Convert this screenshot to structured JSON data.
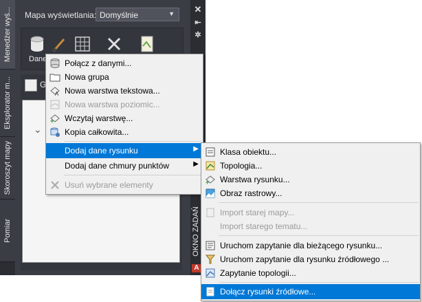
{
  "vertical_tabs": [
    "Menedżer wyś...",
    "Eksplorator m...",
    "Skoroszyt mapy",
    "Pomiar"
  ],
  "map_label": "Mapa wyświetlania:",
  "map_select": "Domyślnie",
  "dane_label": "Dane",
  "g_text": "G",
  "okno_label": "OKNO ZADAŃ",
  "close_icon": "✕",
  "pin_icon": "⇤",
  "settings_icon": "✲",
  "menu1": {
    "items": [
      {
        "label": "Połącz z danymi...",
        "icon": "database-icon",
        "disabled": false
      },
      {
        "label": "Nowa grupa",
        "icon": "folder-icon",
        "disabled": false
      },
      {
        "label": "Nowa warstwa tekstowa...",
        "icon": "text-layer-icon",
        "disabled": false
      },
      {
        "label": "Nowa warstwa poziomic...",
        "icon": "contour-layer-icon",
        "disabled": true
      },
      {
        "label": "Wczytaj warstwę...",
        "icon": "load-layer-icon",
        "disabled": false
      },
      {
        "label": "Kopia całkowita...",
        "icon": "full-copy-icon",
        "disabled": false
      },
      {
        "label": "Dodaj dane rysunku",
        "icon": "",
        "disabled": false,
        "highlighted": true,
        "submenu": true
      },
      {
        "label": "Dodaj dane chmury punktów",
        "icon": "",
        "disabled": false,
        "submenu": true
      },
      {
        "label": "Usuń wybrane elementy",
        "icon": "remove-icon",
        "disabled": true
      }
    ]
  },
  "menu2": {
    "items": [
      {
        "label": "Klasa obiektu...",
        "icon": "feature-class-icon",
        "disabled": false
      },
      {
        "label": "Topologia...",
        "icon": "topology-icon",
        "disabled": false
      },
      {
        "label": "Warstwa rysunku...",
        "icon": "drawing-layer-icon",
        "disabled": false
      },
      {
        "label": "Obraz rastrowy...",
        "icon": "raster-image-icon",
        "disabled": false
      },
      {
        "label": "Import starej mapy...",
        "icon": "import-map-icon",
        "disabled": true
      },
      {
        "label": "Import starego tematu...",
        "icon": "",
        "disabled": true
      },
      {
        "label": "Uruchom zapytanie dla bieżącego rysunku...",
        "icon": "query-current-icon",
        "disabled": false
      },
      {
        "label": "Uruchom zapytanie dla rysunku źródłowego ...",
        "icon": "query-source-icon",
        "disabled": false
      },
      {
        "label": "Zapytanie topologii...",
        "icon": "topology-query-icon",
        "disabled": false
      },
      {
        "label": "Dołącz rysunki źródłowe...",
        "icon": "attach-drawings-icon",
        "disabled": false,
        "highlighted": true
      }
    ]
  }
}
